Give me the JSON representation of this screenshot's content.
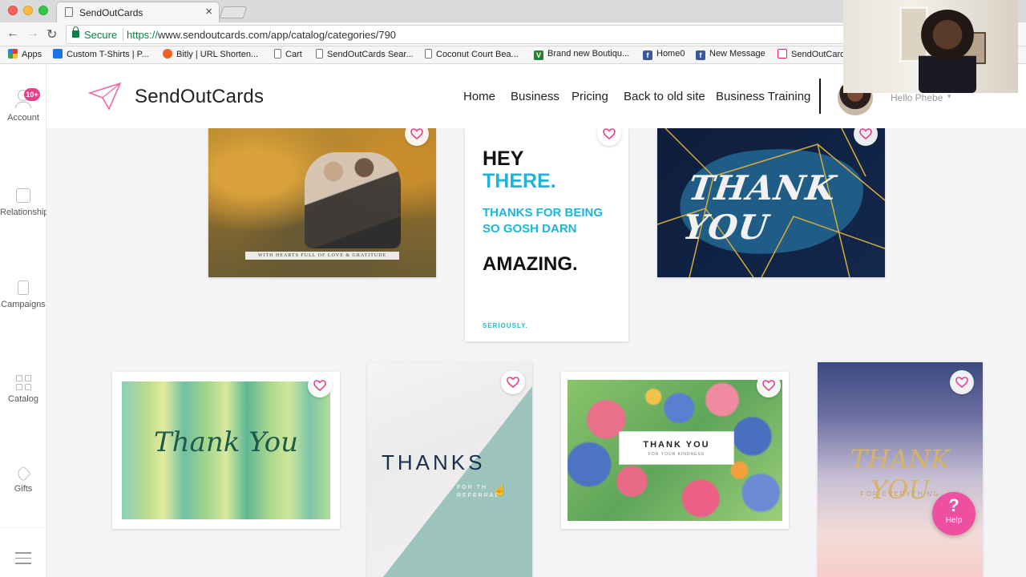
{
  "browser": {
    "tab_title": "SendOutCards",
    "secure_label": "Secure",
    "url_scheme": "https://",
    "url_rest": "www.sendoutcards.com/app/catalog/categories/790",
    "bookmarks": [
      {
        "label": "Apps",
        "icon": "apps-grid-icon"
      },
      {
        "label": "Custom T-Shirts | P...",
        "icon": "shirt-icon"
      },
      {
        "label": "Bitly | URL Shorten...",
        "icon": "bitly-icon"
      },
      {
        "label": "Cart",
        "icon": "page-icon"
      },
      {
        "label": "SendOutCards Sear...",
        "icon": "page-icon"
      },
      {
        "label": "Coconut Court Bea...",
        "icon": "page-icon"
      },
      {
        "label": "Brand new Boutiqu...",
        "icon": "v-icon"
      },
      {
        "label": "Home0",
        "icon": "facebook-icon"
      },
      {
        "label": "New Message",
        "icon": "facebook-icon"
      },
      {
        "label": "SendOutCard",
        "icon": "sendoutcards-icon"
      }
    ]
  },
  "sidebar": {
    "badge": "10+",
    "items": [
      {
        "label": "Account"
      },
      {
        "label": "Relationships"
      },
      {
        "label": "Campaigns"
      },
      {
        "label": "Catalog"
      },
      {
        "label": "Gifts"
      }
    ]
  },
  "header": {
    "logo": "SendOutCards",
    "nav": [
      "Home",
      "Business",
      "Pricing",
      "Back to old site",
      "Business Training"
    ],
    "greeting": "Hello Phebe"
  },
  "cards": {
    "c1": {
      "caption": "WITH HEARTS FULL OF LOVE & GRATITUDE"
    },
    "c2": {
      "line1": "HEY",
      "line2": "THERE.",
      "line3": "THANKS FOR BEING SO GOSH DARN",
      "line4": "AMAZING.",
      "line5": "SERIOUSLY."
    },
    "c3": {
      "text": "THANK YOU"
    },
    "c4": {
      "text": "Thank You"
    },
    "c5": {
      "big": "THANKS",
      "small1": "FOR TH",
      "small2": "REFERRAL"
    },
    "c6": {
      "title": "THANK YOU",
      "subtitle": "FOR YOUR KINDNESS"
    },
    "c7": {
      "title": "THANK YOU",
      "subtitle": "FOR EVERYTHING"
    }
  },
  "help": {
    "icon": "?",
    "label": "Help"
  },
  "colors": {
    "accent": "#e63e8b",
    "heart": "#e63e8b",
    "secure": "#0b8043",
    "teal": "#1fb4d8"
  }
}
